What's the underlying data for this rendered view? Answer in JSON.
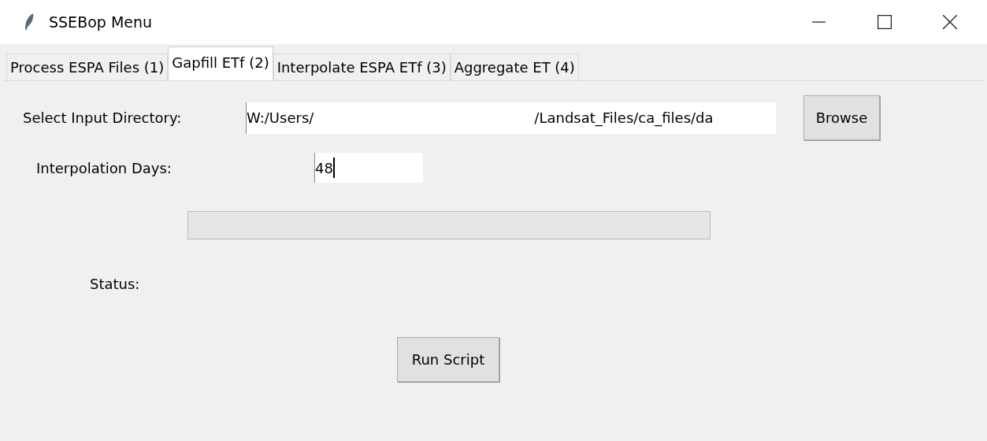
{
  "window": {
    "title": "SSEBop Menu"
  },
  "tabs": [
    {
      "label": "Process ESPA Files (1)",
      "selected": false
    },
    {
      "label": "Gapfill ETf (2)",
      "selected": true
    },
    {
      "label": "Interpolate ESPA ETf (3)",
      "selected": false
    },
    {
      "label": "Aggregate ET (4)",
      "selected": false
    }
  ],
  "input_directory": {
    "label": "Select Input Directory:",
    "value_start": "W:/Users/",
    "value_end": "/Landsat_Files/ca_files/da",
    "button": "Browse"
  },
  "interpolation_days": {
    "label": "Interpolation Days:",
    "value": "48"
  },
  "progress": {
    "level": 0
  },
  "status": {
    "label": "Status:"
  },
  "run_button": "Run Script"
}
